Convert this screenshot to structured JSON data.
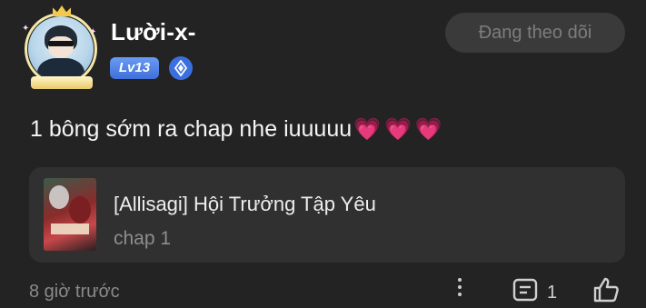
{
  "user": {
    "name": "Lười-x-",
    "level": "Lv13",
    "avatar_frame_text": "— — — — —"
  },
  "follow_button": {
    "label": "Đang theo dõi"
  },
  "comment": {
    "text": "1 bông sớm ra chap nhe iuuuuu",
    "hearts": "💗💗💗"
  },
  "manga": {
    "title": "[Allisagi] Hội Trưởng Tập Yêu",
    "chapter": "chap 1"
  },
  "footer": {
    "timestamp": "8 giờ trước",
    "reply_count": "1"
  },
  "colors": {
    "background": "#232323",
    "card": "#303030",
    "level_badge": "#4f80e6",
    "heart": "#ff4fa3"
  },
  "icons": [
    "avatar-frame",
    "crown-icon",
    "tier-diamond-icon",
    "more-vertical-icon",
    "comment-icon",
    "like-icon"
  ]
}
